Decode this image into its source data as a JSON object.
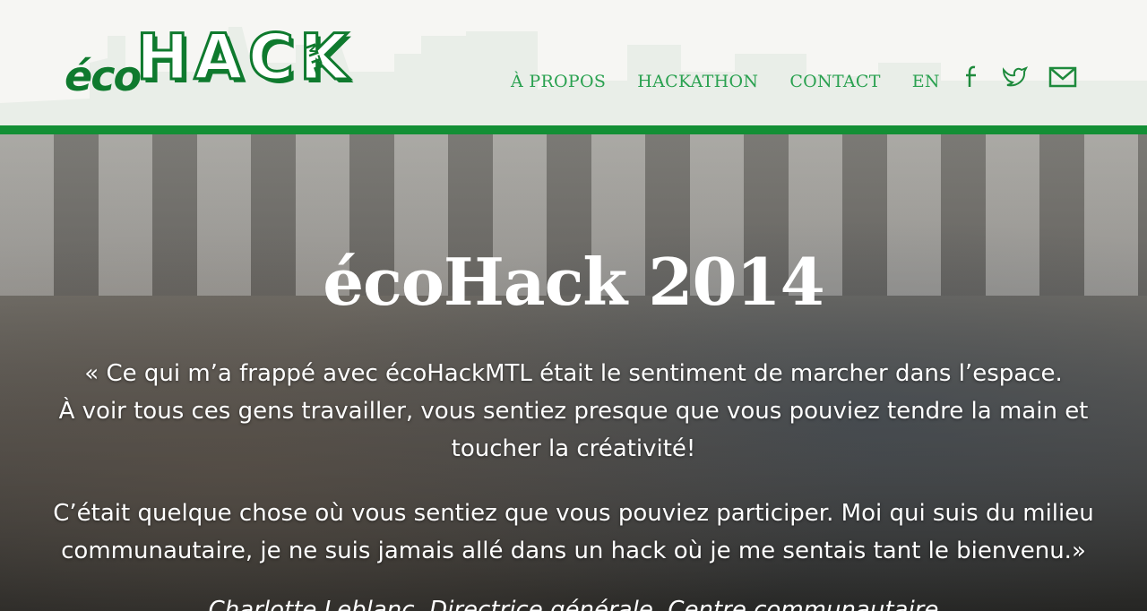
{
  "header": {
    "logo": {
      "eco": "éco",
      "hack": "HACK",
      "mtl": "MTL"
    },
    "nav": [
      "À PROPOS",
      "HACKATHON",
      "CONTACT",
      "EN"
    ],
    "social_icons": [
      "facebook-icon",
      "twitter-icon",
      "email-icon"
    ],
    "accent_color": "#138f35",
    "nav_color": "#2aa150"
  },
  "hero": {
    "title": "écoHack 2014",
    "quote_lines_1": [
      "« Ce qui m’a frappé avec écoHackMTL était le sentiment de marcher dans l’espace.",
      "À voir tous ces gens travailler, vous sentiez presque que vous pouviez tendre la main et",
      "toucher la créativité!"
    ],
    "quote_lines_2": [
      "C’était quelque chose où vous sentiez que vous pouviez participer. Moi qui suis du milieu",
      "communautaire, je ne suis jamais allé dans un hack où je me sentais tant le bienvenu.»"
    ],
    "author": "Charlotte Leblanc, Directrice générale, Centre communautaire"
  }
}
